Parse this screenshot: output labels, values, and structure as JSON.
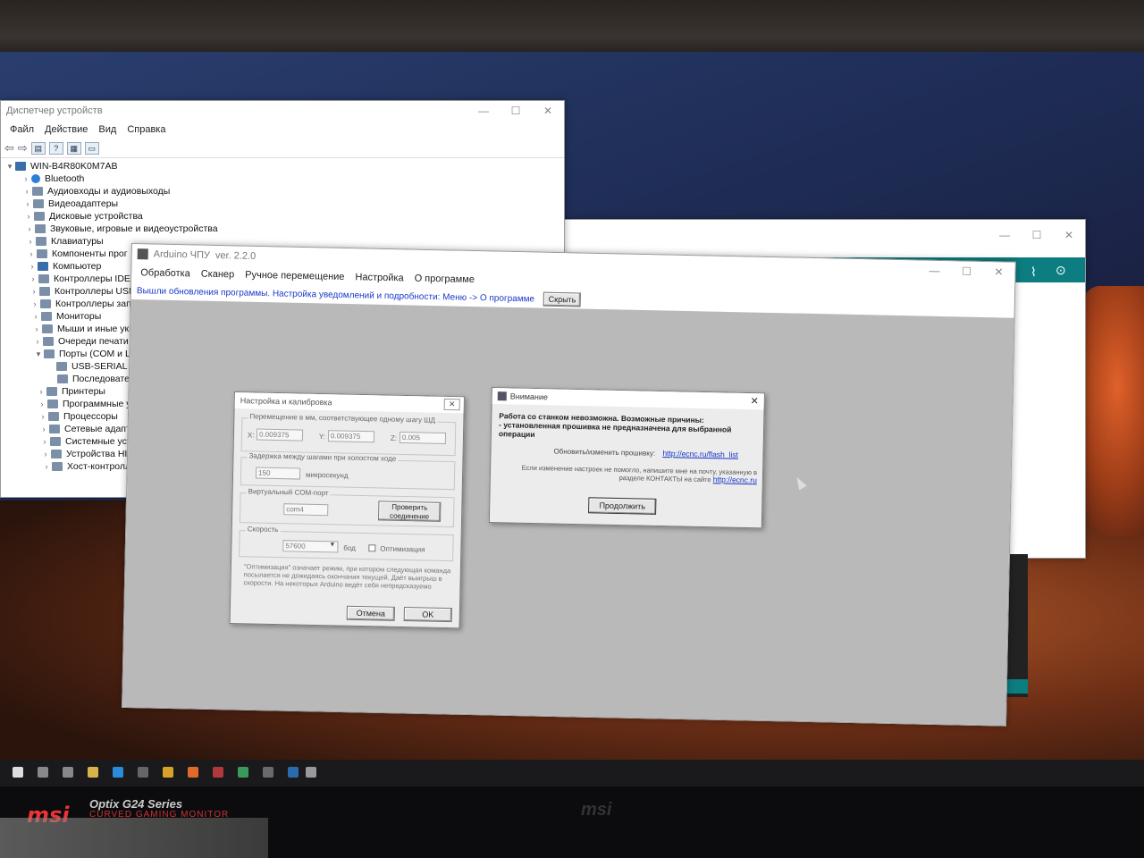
{
  "device_manager": {
    "title": "Диспетчер устройств",
    "menu": [
      "Файл",
      "Действие",
      "Вид",
      "Справка"
    ],
    "root": "WIN-B4R80K0M7AB",
    "items": [
      "Bluetooth",
      "Аудиовходы и аудиовыходы",
      "Видеоадаптеры",
      "Дисковые устройства",
      "Звуковые, игровые и видеоустройства",
      "Клавиатуры",
      "Компоненты прог",
      "Компьютер",
      "Контроллеры IDE",
      "Контроллеры USB",
      "Контроллеры запо",
      "Мониторы",
      "Мыши и иные ука",
      "Очереди печати",
      "Порты (COM и LP",
      "USB-SERIAL CH",
      "Последовател",
      "Принтеры",
      "Программные уст",
      "Процессоры",
      "Сетевые адаптер",
      "Системные устро",
      "Устройства HID (",
      "Хост-контроллер"
    ]
  },
  "arduino": {
    "title": "Arduino ЧПУ",
    "version": "ver. 2.2.0",
    "menu": [
      "Обработка",
      "Сканер",
      "Ручное перемещение",
      "Настройка",
      "О программе"
    ],
    "banner": "Вышли обновления программы. Настройка уведомлений и подробности: Меню -> О программе",
    "hide_button": "Скрыть"
  },
  "settings_dialog": {
    "title": "Настройка и калибровка",
    "move_group": "Перемещение в мм, соответствующее одному шагу ШД",
    "x_label": "X:",
    "x_value": "0.009375",
    "y_label": "Y:",
    "y_value": "0.009375",
    "z_label": "Z:",
    "z_value": "0.005",
    "delay_group": "Задержка между шагами при холостом ходе",
    "delay_value": "150",
    "delay_unit": "микросекунд",
    "com_group": "Виртуальный COM-порт",
    "com_value": "com4",
    "check_button": "Проверить соединение",
    "speed_group": "Скорость",
    "speed_value": "57600",
    "speed_unit": "бод",
    "optimization_label": "Оптимизация",
    "note": "\"Оптимизация\" означает режим, при котором следующая команда посылается не дожидаясь окончания текущей. Даёт выигрыш в скорости. На некоторых Arduino ведёт себя непредсказуемо",
    "cancel_button": "Отмена",
    "ok_button": "OK"
  },
  "attention_dialog": {
    "title": "Внимание",
    "message_bold": "Работа со станком невозможна. Возможные причины:",
    "message_reason": "- установленная прошивка не предназначена для выбранной операции",
    "update_text": "Обновить/изменить прошивку:",
    "update_link": "http://ecnc.ru/flash_list",
    "help_text": "Если изменение настроек не помогло, напишите мне на почту, указанную в разделе КОНТАКТЫ на сайте",
    "help_link": "http://ecnc.ru",
    "continue_button": "Продолжить"
  },
  "monitor": {
    "brand": "msi",
    "model": "Optix G24 Series",
    "subtitle": "CURVED GAMING MONITOR"
  }
}
